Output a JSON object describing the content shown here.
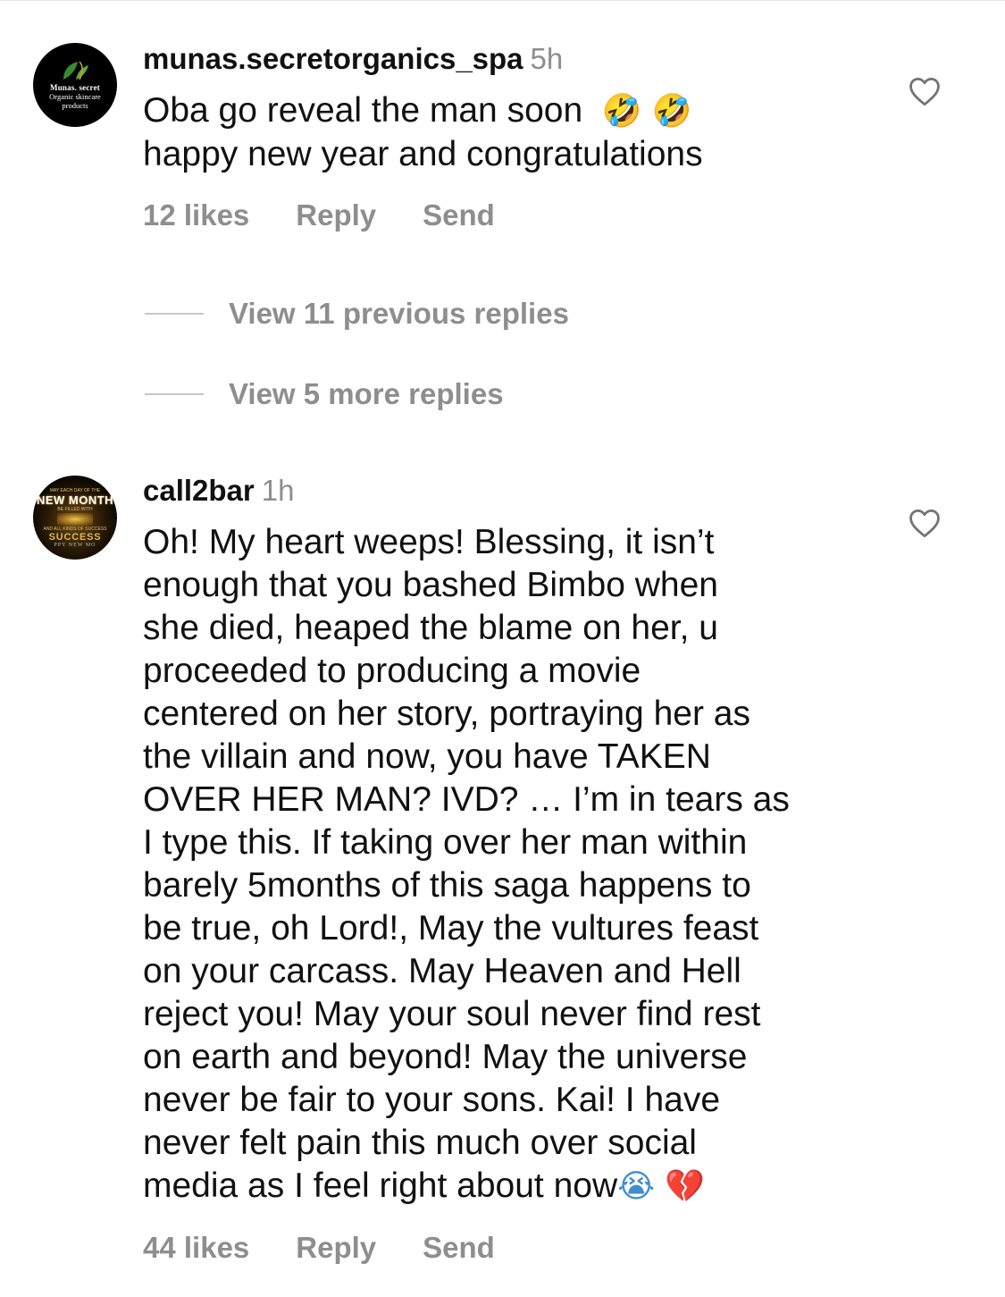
{
  "comments": [
    {
      "avatar": {
        "line1": "Munas. secret",
        "line2": "Organic skincare",
        "line3": "products"
      },
      "username": "munas.secretorganics_spa",
      "time": "5h",
      "text_lines": [
        "Oba go reveal the man soon",
        "happy new year and congratulations"
      ],
      "emojis": [
        "🤣",
        "🤣"
      ],
      "likes": "12 likes",
      "reply": "Reply",
      "send": "Send"
    },
    {
      "avatar": {
        "top": "MAY EACH DAY OF THE",
        "name": "NEW MONTH",
        "mid": "BE FILLED WITH",
        "mid2": "AND ALL KINDS OF SUCCESS",
        "success": "SUCCESS",
        "bottom": "PPY NEW MO"
      },
      "username": "call2bar",
      "time": "1h",
      "text_lines": [
        "Oh! My heart weeps! Blessing, it isn’t",
        "enough that you bashed Bimbo when",
        "she died, heaped the blame on her, u",
        "proceeded to producing a movie",
        "centered on her story, portraying her as",
        "the villain  and now, you have TAKEN",
        "OVER HER MAN?  IVD? …  I’m in tears as",
        "I type this. If taking over her man within",
        "barely 5months of this saga happens to",
        "be true, oh Lord!, May the vultures feast",
        "on your carcass. May Heaven and Hell",
        "reject you! May your soul never find rest",
        "on earth and beyond!  May the universe",
        "never be fair to your sons. Kai! I have",
        "never felt pain this much over social",
        "media as I feel right about now"
      ],
      "emojis": [
        "😭",
        "💔"
      ],
      "likes": "44 likes",
      "reply": "Reply",
      "send": "Send"
    }
  ],
  "view_previous": "View 11 previous replies",
  "view_more": "View 5 more replies",
  "icons": {
    "like": "heart-outline-icon"
  }
}
